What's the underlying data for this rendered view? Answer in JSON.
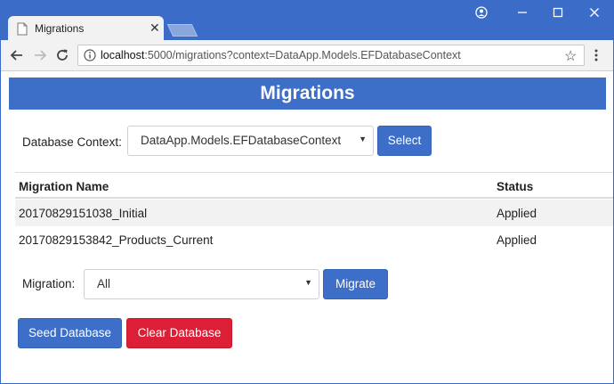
{
  "browser": {
    "tab_title": "Migrations",
    "tab_close": "✕",
    "url_host": "localhost",
    "url_path": ":5000/migrations?context=DataApp.Models.EFDatabaseContext"
  },
  "page": {
    "title": "Migrations"
  },
  "context": {
    "label": "Database Context:",
    "selected": "DataApp.Models.EFDatabaseContext",
    "select_button": "Select"
  },
  "table": {
    "headers": [
      "Migration Name",
      "Status"
    ],
    "rows": [
      {
        "name": "20170829151038_Initial",
        "status": "Applied"
      },
      {
        "name": "20170829153842_Products_Current",
        "status": "Applied"
      }
    ]
  },
  "migration": {
    "label": "Migration:",
    "selected": "All",
    "migrate_button": "Migrate"
  },
  "actions": {
    "seed_button": "Seed Database",
    "clear_button": "Clear Database"
  },
  "colors": {
    "primary": "#3d6ec8",
    "danger": "#dc1f36",
    "titlebar": "#3b6cc8"
  }
}
